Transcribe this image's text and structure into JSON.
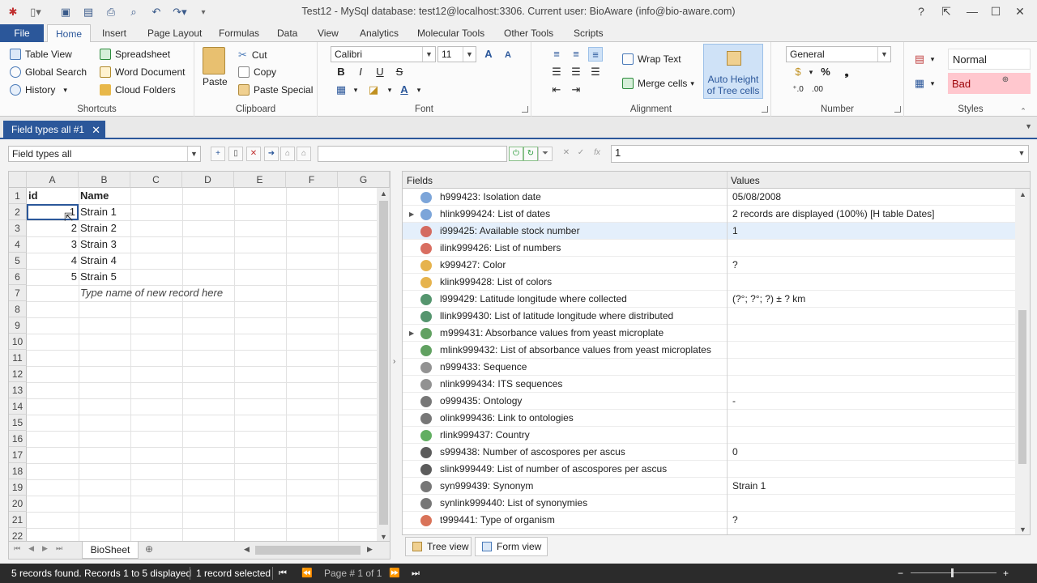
{
  "window": {
    "title": "Test12 - MySql database: test12@localhost:3306. Current user: BioAware (info@bio-aware.com)",
    "help": "?"
  },
  "ribbon_tabs": [
    "File",
    "Home",
    "Insert",
    "Page Layout",
    "Formulas",
    "Data",
    "View",
    "Analytics",
    "Molecular Tools",
    "Other Tools",
    "Scripts"
  ],
  "shortcuts": {
    "items": [
      "Table View",
      "Global Search",
      "History",
      "Spreadsheet",
      "Word Document",
      "Cloud Folders"
    ],
    "label": "Shortcuts"
  },
  "clipboard": {
    "paste": "Paste",
    "cut": "Cut",
    "copy": "Copy",
    "paste_special": "Paste Special",
    "label": "Clipboard"
  },
  "font": {
    "family": "Calibri",
    "size": "11",
    "bold": "B",
    "italic": "I",
    "underline": "U",
    "strike": "S",
    "label": "Font"
  },
  "alignment": {
    "wrap_text": "Wrap Text",
    "merge_cells": "Merge cells",
    "auto_height": "Auto Height",
    "of_tree_cells": "of Tree cells",
    "label": "Alignment"
  },
  "number": {
    "format": "General",
    "percent": "%",
    "comma": "❟",
    "label": "Number"
  },
  "styles": {
    "normal": "Normal",
    "bad": "Bad",
    "label": "Styles"
  },
  "doc_tab": "Field types all #1",
  "toolbar": {
    "view_select": "Field types all",
    "search_value": "",
    "formula_value": "1"
  },
  "sheet": {
    "columns": [
      "A",
      "B",
      "C",
      "D",
      "E",
      "F",
      "G"
    ],
    "rows": [
      "1",
      "2",
      "3",
      "4",
      "5",
      "6",
      "7",
      "8",
      "9",
      "10",
      "11",
      "12",
      "13",
      "14",
      "15",
      "16",
      "17",
      "18",
      "19",
      "20",
      "21",
      "22"
    ],
    "header": {
      "a": "id",
      "b": "Name"
    },
    "records": [
      {
        "id": "1",
        "name": "Strain 1"
      },
      {
        "id": "2",
        "name": "Strain 2"
      },
      {
        "id": "3",
        "name": "Strain 3"
      },
      {
        "id": "4",
        "name": "Strain 4"
      },
      {
        "id": "5",
        "name": "Strain 5"
      }
    ],
    "new_record_hint": "Type name of new record here",
    "sheet_tab": "BioSheet"
  },
  "fields_panel": {
    "col_fields": "Fields",
    "col_values": "Values",
    "rows": [
      {
        "name": "h999423: Isolation date",
        "value": "05/08/2008",
        "icon": "#5b8fd0"
      },
      {
        "name": "hlink999424: List of dates",
        "value": " 2 records are displayed (100%) [H table Dates]",
        "icon": "#5b8fd0"
      },
      {
        "name": "i999425: Available stock number",
        "value": "1",
        "icon": "#d04a3a"
      },
      {
        "name": "ilink999426: List of numbers",
        "value": "",
        "icon": "#d04a3a"
      },
      {
        "name": "k999427: Color",
        "value": "?",
        "icon": "#e0a020"
      },
      {
        "name": "klink999428: List of colors",
        "value": "",
        "icon": "#e0a020"
      },
      {
        "name": "l999429: Latitude longitude where collected",
        "value": "(?°; ?°; ?) ± ? km",
        "icon": "#2a7a4a"
      },
      {
        "name": "llink999430: List of latitude longitude where distributed",
        "value": "",
        "icon": "#2a7a4a"
      },
      {
        "name": "m999431: Absorbance values from yeast microplate",
        "value": "",
        "icon": "#3a8a3a"
      },
      {
        "name": "mlink999432: List of absorbance values from yeast microplates",
        "value": "",
        "icon": "#3a8a3a"
      },
      {
        "name": "n999433: Sequence",
        "value": "",
        "icon": "#777777"
      },
      {
        "name": "nlink999434: ITS sequences",
        "value": "",
        "icon": "#777777"
      },
      {
        "name": "o999435: Ontology",
        "value": "-",
        "icon": "#555555"
      },
      {
        "name": "olink999436: Link to ontologies",
        "value": "",
        "icon": "#555555"
      },
      {
        "name": "rlink999437: Country",
        "value": "",
        "icon": "#3a9a3a"
      },
      {
        "name": "s999438: Number of ascospores per ascus",
        "value": "0",
        "icon": "#333333"
      },
      {
        "name": "slink999449: List of number of ascospores per ascus",
        "value": "",
        "icon": "#333333"
      },
      {
        "name": "syn999439: Synonym",
        "value": "Strain 1",
        "icon": "#555555"
      },
      {
        "name": "synlink999440: List of synonymies",
        "value": "",
        "icon": "#555555"
      },
      {
        "name": "t999441: Type of organism",
        "value": "?",
        "icon": "#d05030"
      }
    ]
  },
  "view_tabs": {
    "tree": "Tree view",
    "form": "Form view"
  },
  "status": {
    "records": "5 records found. Records 1 to 5 displayed",
    "selected": "1 record selected",
    "page": "Page # 1 of 1",
    "zoom_minus": "−",
    "zoom_plus": "+"
  },
  "colors": {
    "accent": "#2b579a",
    "bad_bg": "#ffc7ce",
    "bad_fg": "#9c0006"
  }
}
